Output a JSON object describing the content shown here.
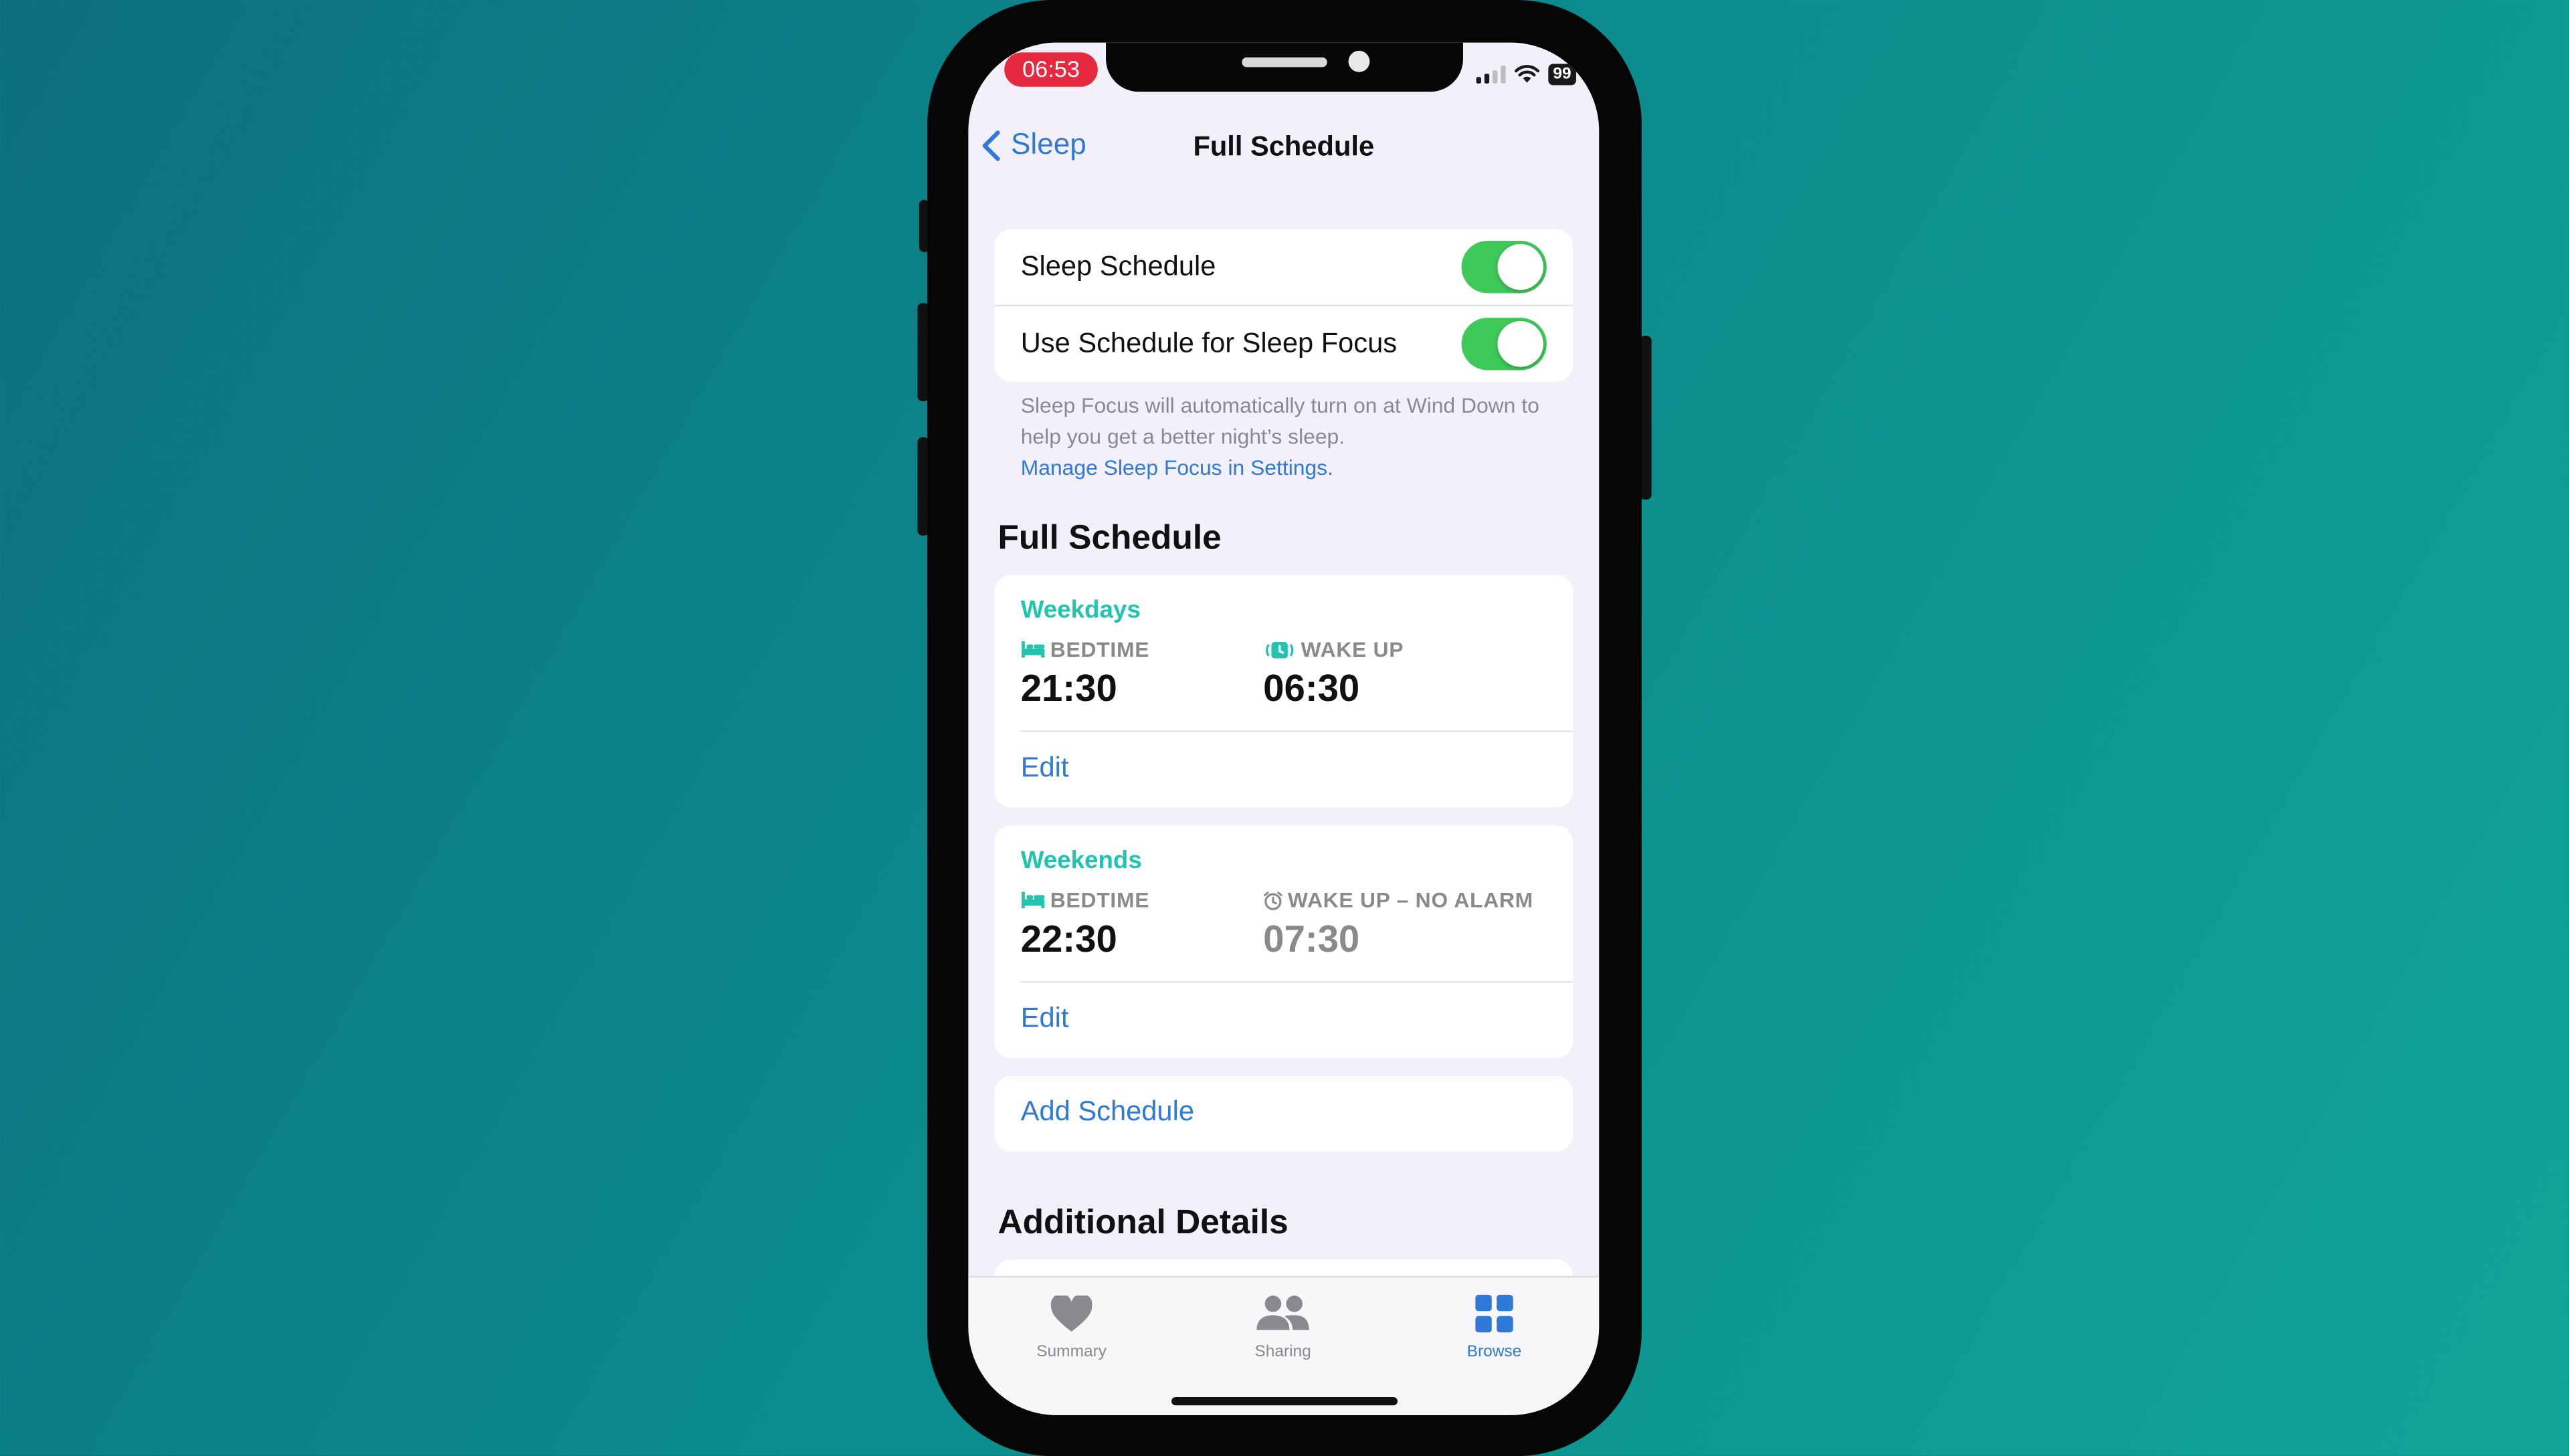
{
  "status_bar": {
    "time": "06:53",
    "battery": "99"
  },
  "nav": {
    "back_label": "Sleep",
    "title": "Full Schedule"
  },
  "toggles": [
    {
      "label": "Sleep Schedule",
      "on": true
    },
    {
      "label": "Use Schedule for Sleep Focus",
      "on": true
    }
  ],
  "footnote": {
    "text": "Sleep Focus will automatically turn on at Wind Down to help you get a better night’s sleep.",
    "link": "Manage Sleep Focus in Settings."
  },
  "full_schedule": {
    "heading": "Full Schedule",
    "schedules": [
      {
        "title": "Weekdays",
        "bedtime_label": "BEDTIME",
        "bedtime": "21:30",
        "wake_label": "WAKE UP",
        "wake": "06:30",
        "edit": "Edit"
      },
      {
        "title": "Weekends",
        "bedtime_label": "BEDTIME",
        "bedtime": "22:30",
        "wake_label": "WAKE UP – NO ALARM",
        "wake": "07:30",
        "edit": "Edit"
      }
    ],
    "add_label": "Add Schedule"
  },
  "additional_heading": "Additional Details",
  "tabs": [
    {
      "label": "Summary",
      "icon": "heart-icon",
      "active": false
    },
    {
      "label": "Sharing",
      "icon": "people-icon",
      "active": false
    },
    {
      "label": "Browse",
      "icon": "grid-icon",
      "active": true
    }
  ],
  "colors": {
    "accent": "#2f7ad6",
    "toggle_on": "#3fc959",
    "schedule_title": "#22c4b0",
    "clock_pill": "#e5293f"
  }
}
